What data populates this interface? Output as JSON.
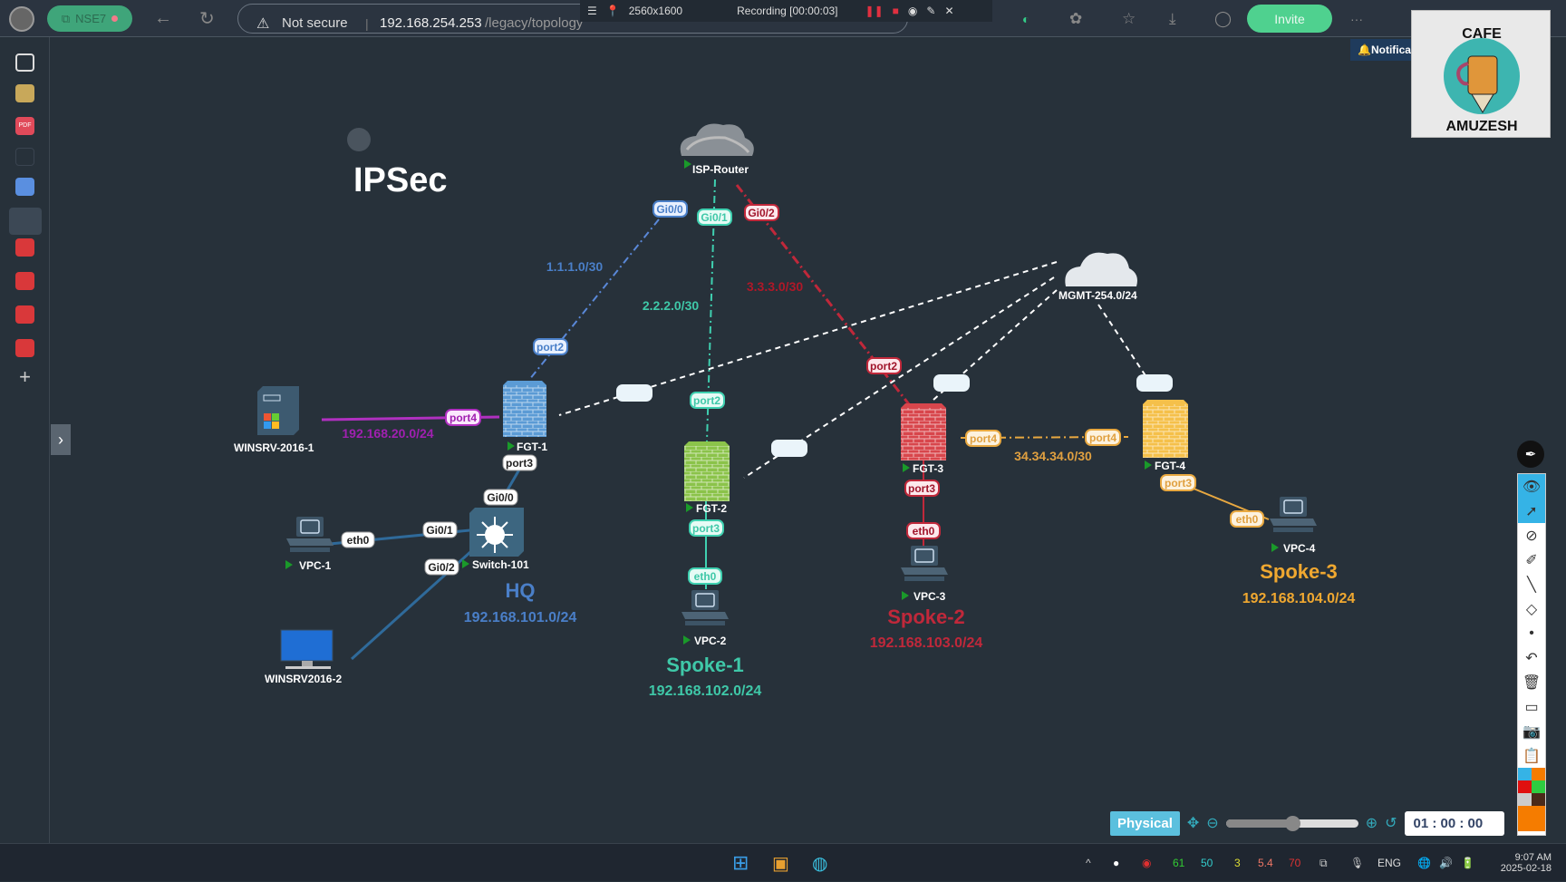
{
  "browser": {
    "profile": "NSE7",
    "security": "Not secure",
    "url_host": "192.168.254.253",
    "url_path": "/legacy/topology",
    "invite": "Invite",
    "more": "···"
  },
  "recorder": {
    "resolution": "2560x1600",
    "status": "Recording [00:00:03]"
  },
  "notifications": "Notifications",
  "logo_text": "CAFE AMUZESH",
  "topology": {
    "title": "IPSec",
    "nodes": {
      "isp": "ISP-Router",
      "mgmt": "MGMT-254.0/24",
      "fgt1": "FGT-1",
      "fgt2": "FGT-2",
      "fgt3": "FGT-3",
      "fgt4": "FGT-4",
      "winsrv1": "WINSRV-2016-1",
      "winsrv2": "WINSRV2016-2",
      "switch": "Switch-101",
      "vpc1": "VPC-1",
      "vpc2": "VPC-2",
      "vpc3": "VPC-3",
      "vpc4": "VPC-4"
    },
    "ports": {
      "isp_gi00": "Gi0/0",
      "isp_gi01": "Gi0/1",
      "isp_gi02": "Gi0/2",
      "fgt1_port2": "port2",
      "fgt1_port3": "port3",
      "fgt1_port4": "port4",
      "fgt2_port2": "port2",
      "fgt2_port3": "port3",
      "fgt3_port2": "port2",
      "fgt3_port3": "port3",
      "fgt3_port4": "port4",
      "fgt4_port4": "port4",
      "fgt4_port3": "port3",
      "sw_gi00": "Gi0/0",
      "sw_gi01": "Gi0/1",
      "sw_gi02": "Gi0/2",
      "vpc1_eth0": "eth0",
      "vpc2_eth0": "eth0",
      "vpc3_eth0": "eth0",
      "vpc4_eth0": "eth0"
    },
    "links": {
      "isp_fgt1": "1.1.1.0/30",
      "isp_fgt2": "2.2.2.0/30",
      "isp_fgt3": "3.3.3.0/30",
      "fgt3_fgt4": "34.34.34.0/30",
      "winsrv_net": "192.168.20.0/24"
    },
    "sites": [
      {
        "name": "HQ",
        "subnet": "192.168.101.0/24",
        "color": "#4a7fc8"
      },
      {
        "name": "Spoke-1",
        "subnet": "192.168.102.0/24",
        "color": "#3fc8a8"
      },
      {
        "name": "Spoke-2",
        "subnet": "192.168.103.0/24",
        "color": "#c0283a"
      },
      {
        "name": "Spoke-3",
        "subnet": "192.168.104.0/24",
        "color": "#f0a830"
      }
    ]
  },
  "toolbar": {
    "mode": "Physical",
    "timer": "01 : 00 : 00",
    "zoom_level": 0.5
  },
  "taskbar": {
    "stats": [
      "61",
      "50",
      "3",
      "5.4",
      "70"
    ],
    "lang": "ENG",
    "time": "9:07 AM",
    "date": "2025-02-18"
  }
}
